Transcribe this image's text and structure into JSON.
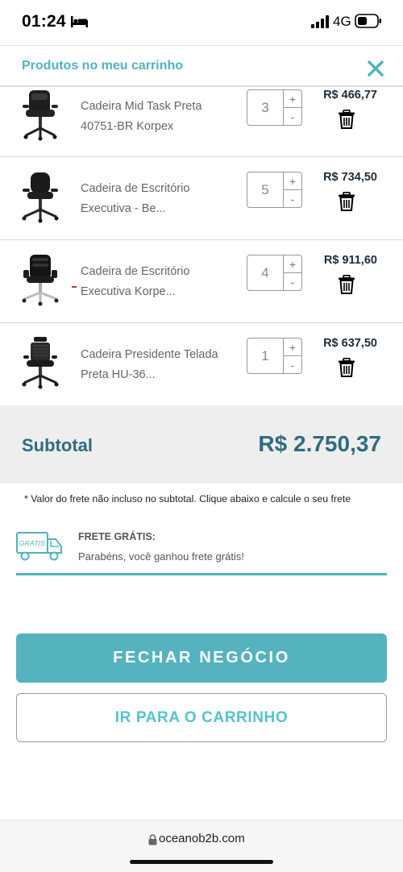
{
  "status_bar": {
    "time": "01:24",
    "network": "4G",
    "icons": [
      "bed-icon",
      "signal-icon",
      "battery-icon"
    ]
  },
  "cart": {
    "title": "Produtos no meu carrinho",
    "close_icon": "close-icon"
  },
  "items": [
    {
      "name": "Cadeira Mid Task Preta 40751-BR Korpex",
      "quantity": "3",
      "plus": "+",
      "minus": "-",
      "price": "R$ 466,77"
    },
    {
      "name": "Cadeira de Escritório Executiva - Be...",
      "quantity": "5",
      "plus": "+",
      "minus": "-",
      "price": "R$ 734,50"
    },
    {
      "name": "Cadeira de Escritório Executiva Korpe...",
      "quantity": "4",
      "plus": "+",
      "minus": "-",
      "price": "R$ 911,60"
    },
    {
      "name": "Cadeira Presidente Telada Preta HU-36...",
      "quantity": "1",
      "plus": "+",
      "minus": "-",
      "price": "R$ 637,50"
    }
  ],
  "subtotal": {
    "label": "Subtotal",
    "value": "R$ 2.750,37"
  },
  "freight_note": "* Valor do frete não incluso no subtotal. Clique abaixo e calcule o seu frete",
  "free_shipping": {
    "badge": "GRÁTIS",
    "title": "FRETE GRÁTIS:",
    "text": "Parabéns, você ganhou frete grátis!"
  },
  "actions": {
    "checkout": "FECHAR NEGÓCIO",
    "go_to_cart": "IR PARA O CARRINHO"
  },
  "browser": {
    "url": "oceanob2b.com"
  },
  "colors": {
    "accent": "#4fb3bf",
    "subtotal_text": "#2f6c80",
    "price_text": "#1d2b3a"
  }
}
